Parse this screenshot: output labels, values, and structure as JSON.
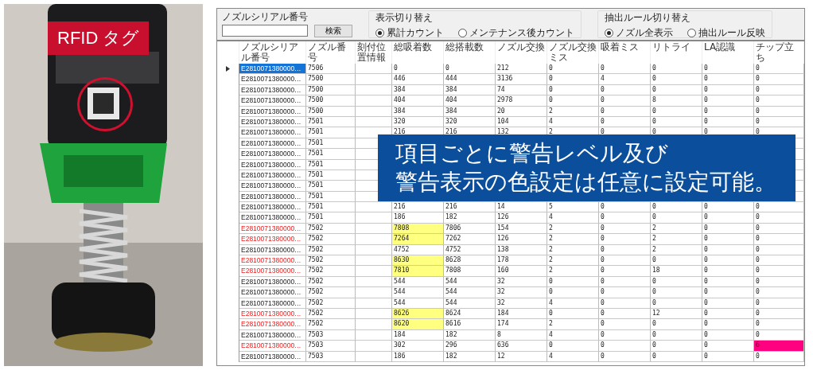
{
  "photo": {
    "label": "RFID タグ"
  },
  "search": {
    "label": "ノズルシリアル番号",
    "button": "検索"
  },
  "display_mode": {
    "title": "表示切り替え",
    "options": [
      {
        "label": "累計カウント",
        "selected": true
      },
      {
        "label": "メンテナンス後カウント",
        "selected": false
      }
    ]
  },
  "filter_mode": {
    "title": "抽出ルール切り替え",
    "options": [
      {
        "label": "ノズル全表示",
        "selected": true
      },
      {
        "label": "抽出ルール反映",
        "selected": false
      }
    ]
  },
  "table": {
    "columns": [
      "ノズルシリアル番号",
      "ノズル番号",
      "刻付位置情報",
      "総吸着数",
      "総搭載数",
      "ノズル交換",
      "ノズル交換ミス",
      "吸着ミス",
      "リトライ",
      "LA認識",
      "チップ立ち"
    ],
    "rows": [
      {
        "selected": true,
        "alert": false,
        "serial": "E2810071380000…",
        "nozzle": "7506",
        "values": [
          "0",
          "0",
          "212",
          "0",
          "0",
          "0",
          "0",
          "0"
        ]
      },
      {
        "selected": false,
        "alert": false,
        "serial": "E2810071380000…",
        "nozzle": "7500",
        "values": [
          "446",
          "444",
          "3136",
          "0",
          "4",
          "0",
          "0",
          "0"
        ]
      },
      {
        "selected": false,
        "alert": false,
        "serial": "E2810071380000…",
        "nozzle": "7500",
        "values": [
          "384",
          "384",
          "74",
          "0",
          "0",
          "0",
          "0",
          "0"
        ]
      },
      {
        "selected": false,
        "alert": false,
        "serial": "E2810071380000…",
        "nozzle": "7500",
        "values": [
          "404",
          "404",
          "2978",
          "0",
          "0",
          "8",
          "0",
          "0"
        ]
      },
      {
        "selected": false,
        "alert": false,
        "serial": "E2810071380000…",
        "nozzle": "7500",
        "values": [
          "384",
          "384",
          "20",
          "2",
          "0",
          "0",
          "0",
          "0"
        ]
      },
      {
        "selected": false,
        "alert": false,
        "serial": "E2810071380000…",
        "nozzle": "7501",
        "values": [
          "320",
          "320",
          "104",
          "4",
          "0",
          "0",
          "0",
          "0"
        ]
      },
      {
        "selected": false,
        "alert": false,
        "serial": "E2810071380000…",
        "nozzle": "7501",
        "values": [
          "216",
          "216",
          "132",
          "2",
          "0",
          "0",
          "0",
          "0"
        ]
      },
      {
        "selected": false,
        "alert": false,
        "serial": "E2810071380000…",
        "nozzle": "7501"
      },
      {
        "selected": false,
        "alert": false,
        "serial": "E2810071380000…",
        "nozzle": "7501"
      },
      {
        "selected": false,
        "alert": false,
        "serial": "E2810071380000…",
        "nozzle": "7501"
      },
      {
        "selected": false,
        "alert": false,
        "serial": "E2810071380000…",
        "nozzle": "7501"
      },
      {
        "selected": false,
        "alert": false,
        "serial": "E2810071380000…",
        "nozzle": "7501"
      },
      {
        "selected": false,
        "alert": false,
        "serial": "E2810071380000…",
        "nozzle": "7501"
      },
      {
        "selected": false,
        "alert": false,
        "serial": "E2810071380000…",
        "nozzle": "7501",
        "values": [
          "216",
          "216",
          "14",
          "5",
          "0",
          "0",
          "0",
          "0"
        ]
      },
      {
        "selected": false,
        "alert": false,
        "serial": "E2810071380000…",
        "nozzle": "7501",
        "values": [
          "186",
          "182",
          "126",
          "4",
          "0",
          "0",
          "0",
          "0"
        ]
      },
      {
        "selected": false,
        "alert": true,
        "serial": "E2810071380000…",
        "nozzle": "7502",
        "values": [
          {
            "text": "7808",
            "color": "#ffff80"
          },
          "7806",
          "154",
          "2",
          "0",
          "2",
          "0",
          "0"
        ]
      },
      {
        "selected": false,
        "alert": true,
        "serial": "E2810071380000…",
        "nozzle": "7502",
        "values": [
          {
            "text": "7264",
            "color": "#ffff80"
          },
          "7262",
          "126",
          "2",
          "0",
          "2",
          "0",
          "0"
        ]
      },
      {
        "selected": false,
        "alert": false,
        "serial": "E2810071380000…",
        "nozzle": "7502",
        "values": [
          "4752",
          "4752",
          "138",
          "2",
          "0",
          "2",
          "0",
          "0"
        ]
      },
      {
        "selected": false,
        "alert": true,
        "serial": "E2810071380000…",
        "nozzle": "7502",
        "values": [
          {
            "text": "8630",
            "color": "#ffff80"
          },
          "8628",
          "178",
          "2",
          "0",
          "0",
          "0",
          "0"
        ]
      },
      {
        "selected": false,
        "alert": true,
        "serial": "E2810071380000…",
        "nozzle": "7502",
        "values": [
          {
            "text": "7810",
            "color": "#ffff80"
          },
          "7808",
          "160",
          "2",
          "0",
          "18",
          "0",
          "0"
        ]
      },
      {
        "selected": false,
        "alert": false,
        "serial": "E2810071380000…",
        "nozzle": "7502",
        "values": [
          "544",
          "544",
          "32",
          "0",
          "0",
          "0",
          "0",
          "0"
        ]
      },
      {
        "selected": false,
        "alert": false,
        "serial": "E2810071380000…",
        "nozzle": "7502",
        "values": [
          "544",
          "544",
          "32",
          "0",
          "0",
          "0",
          "0",
          "0"
        ]
      },
      {
        "selected": false,
        "alert": false,
        "serial": "E2810071380000…",
        "nozzle": "7502",
        "values": [
          "544",
          "544",
          "32",
          "4",
          "0",
          "0",
          "0",
          "0"
        ]
      },
      {
        "selected": false,
        "alert": true,
        "serial": "E2810071380000…",
        "nozzle": "7502",
        "values": [
          {
            "text": "8626",
            "color": "#ffff80"
          },
          "8624",
          "184",
          "0",
          "0",
          "12",
          "0",
          "0"
        ]
      },
      {
        "selected": false,
        "alert": true,
        "serial": "E2810071380000…",
        "nozzle": "7502",
        "values": [
          {
            "text": "8620",
            "color": "#ffff80"
          },
          "8616",
          "174",
          "2",
          "0",
          "0",
          "0",
          "0"
        ]
      },
      {
        "selected": false,
        "alert": false,
        "serial": "E2810071380000…",
        "nozzle": "7503",
        "values": [
          "184",
          "182",
          "8",
          "4",
          "0",
          "0",
          "0",
          "0"
        ]
      },
      {
        "selected": false,
        "alert": true,
        "serial": "E2810071380000…",
        "nozzle": "7503",
        "values": [
          "302",
          "296",
          "636",
          "0",
          "0",
          "0",
          "0",
          {
            "text": "6",
            "color": "#ff0080"
          }
        ]
      },
      {
        "selected": false,
        "alert": false,
        "serial": "E2810071380000…",
        "nozzle": "7503",
        "values": [
          "186",
          "182",
          "12",
          "4",
          "0",
          "0",
          "0",
          "0"
        ]
      }
    ]
  },
  "callout": [
    "項目ごとに警告レベル及び",
    "警告表示の色設定は任意に設定可能。"
  ]
}
